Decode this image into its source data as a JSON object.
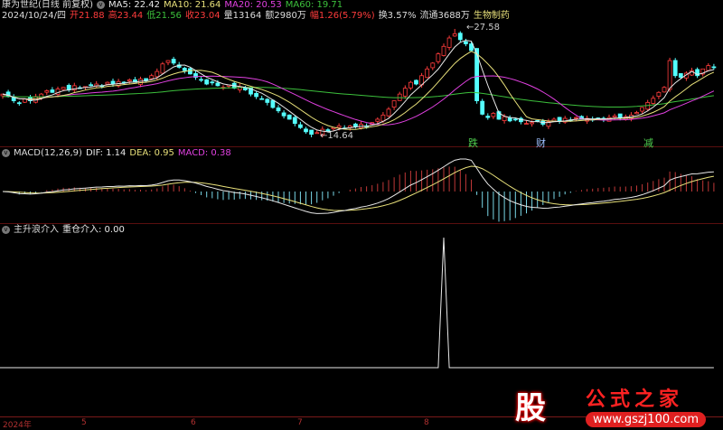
{
  "header": {
    "stock_name": "康为世纪(日线 前复权)",
    "ma5": "MA5: 22.42",
    "ma10": "MA10: 21.64",
    "ma20": "MA20: 20.53",
    "ma60": "MA60: 19.71",
    "date": "2024/10/24/四",
    "open": "开21.88",
    "high": "高23.44",
    "low": "低21.56",
    "close": "收23.04",
    "volume": "量13164",
    "amount": "额2980万",
    "change": "幅1.26(5.79%)",
    "turnover": "换3.57%",
    "float": "流通3688万",
    "industry": "生物制药"
  },
  "main_chart": {
    "high_label": "27.58",
    "low_label": "14.64",
    "signals": [
      {
        "text": "跌",
        "color": "#4fd04f"
      },
      {
        "text": "财",
        "color": "#9fc0ff"
      },
      {
        "text": "减",
        "color": "#4fd04f"
      }
    ]
  },
  "macd": {
    "title": "MACD(12,26,9)",
    "dif": "DIF: 1.14",
    "dea": "DEA: 0.95",
    "macd": "MACD: 0.38"
  },
  "indicator": {
    "title": "主升浪介入",
    "value": "重仓介入: 0.00"
  },
  "x_axis": [
    "2024年",
    "5",
    "6",
    "7",
    "8"
  ],
  "logo": {
    "mark": "股",
    "name": "公式之家",
    "url": "www.gszj100.com"
  },
  "colors": {
    "up": "#ff3c3c",
    "down": "#54ffff",
    "ma5": "#e8e8e8",
    "ma10": "#e8e07a",
    "ma20": "#e040e0",
    "ma60": "#3cc03c"
  },
  "chart_data": {
    "type": "candlestick",
    "closes": [
      19.8,
      19.5,
      19.0,
      18.7,
      19.2,
      19.0,
      19.5,
      19.8,
      20.2,
      20.0,
      20.4,
      20.6,
      20.3,
      20.8,
      20.5,
      20.7,
      20.9,
      21.0,
      20.8,
      21.2,
      21.0,
      21.3,
      21.1,
      21.5,
      21.2,
      21.6,
      21.4,
      22.0,
      22.5,
      23.4,
      23.8,
      23.5,
      23.0,
      22.6,
      22.2,
      21.8,
      21.5,
      21.0,
      21.2,
      20.8,
      20.6,
      20.9,
      20.5,
      20.7,
      20.3,
      19.8,
      19.5,
      19.2,
      18.8,
      18.2,
      17.8,
      17.2,
      16.8,
      16.3,
      15.8,
      15.3,
      15.0,
      15.2,
      15.6,
      15.4,
      15.8,
      16.0,
      15.7,
      16.0,
      15.9,
      16.2,
      16.0,
      16.4,
      16.8,
      17.3,
      18.0,
      19.0,
      19.8,
      20.5,
      21.2,
      21.0,
      22.0,
      22.8,
      23.5,
      24.6,
      25.5,
      26.5,
      27.0,
      26.3,
      25.8,
      25.0,
      19.0,
      17.4,
      17.0,
      17.5,
      16.8,
      17.1,
      16.6,
      16.8,
      16.5,
      16.3,
      16.4,
      16.6,
      16.2,
      16.5,
      16.8,
      16.6,
      16.9,
      16.7,
      17.0,
      16.8,
      16.9,
      16.7,
      16.9,
      16.8,
      17.0,
      17.2,
      16.9,
      17.1,
      17.3,
      17.6,
      18.2,
      18.8,
      19.3,
      20.0,
      20.6,
      23.8,
      22.0,
      21.8,
      22.3,
      22.6,
      22.0,
      22.8,
      23.2,
      23.04
    ],
    "price_range": [
      14.64,
      27.58
    ],
    "signal_bar": 80
  }
}
